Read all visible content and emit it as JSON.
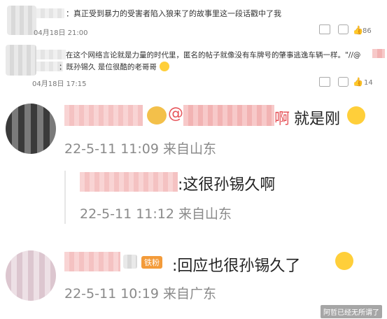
{
  "comment1": {
    "text": "：真正受到暴力的受害者陷入狼来了的故事里这一段话戳中了我",
    "date": "04月18日 21:00",
    "likes": "86"
  },
  "comment2": {
    "text_line1": "在这个网络言论就是力量的时代里，匿名的帖子就像没有车牌号的肇事逃逸车辆一样。\"//@",
    "text_line2": "：既孙锡久 是位很酷的老哥哥",
    "date": "04月18日 17:15",
    "likes": "14"
  },
  "comment3": {
    "mention": "@",
    "mention_tail": "啊",
    "text": "就是刚",
    "meta": "22-5-11 11:09 来自山东"
  },
  "reply1": {
    "text": ":这很孙锡久啊",
    "meta": "22-5-11 11:12 来自山东"
  },
  "comment4": {
    "badge": "铁粉",
    "text": ":回应也很孙锡久了",
    "meta": "22-5-11 10:19 来自广东"
  },
  "watermark": "阿哲已经无所谓了",
  "colors": {
    "badge": "#f39b3a",
    "mention": "#e6545a"
  }
}
